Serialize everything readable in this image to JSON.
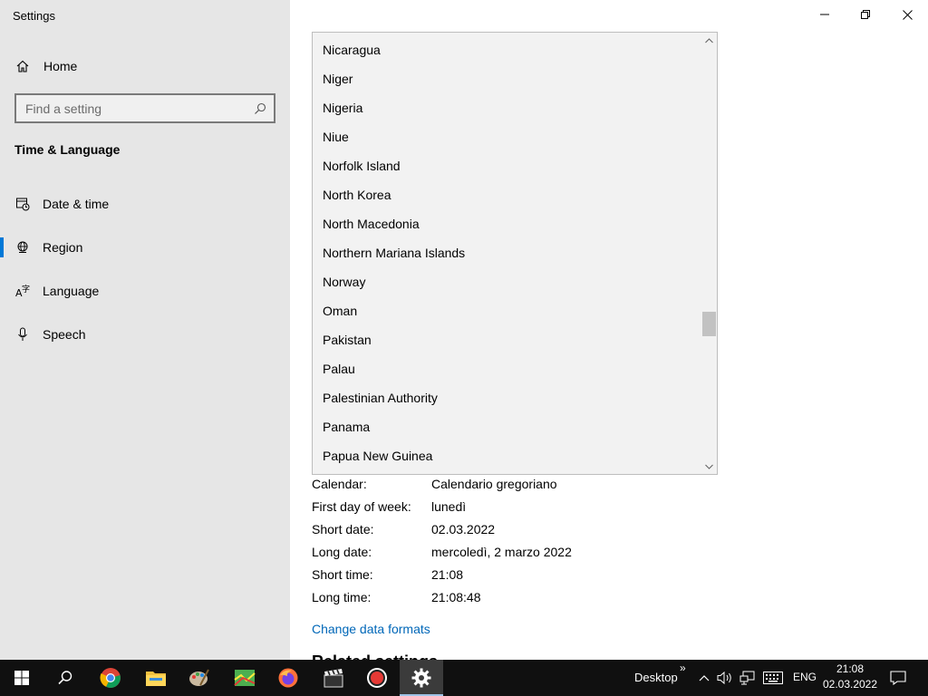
{
  "window": {
    "title": "Settings",
    "minimize_icon": "minimize-icon",
    "restore_icon": "restore-icon",
    "close_icon": "close-icon"
  },
  "sidebar": {
    "home": {
      "label": "Home",
      "icon": "home-icon"
    },
    "search": {
      "placeholder": "Find a setting",
      "value": "",
      "icon": "search-icon"
    },
    "section_title": "Time & Language",
    "items": [
      {
        "label": "Date & time",
        "icon": "calendar-clock-icon",
        "selected": false
      },
      {
        "label": "Region",
        "icon": "globe-icon",
        "selected": true
      },
      {
        "label": "Language",
        "icon": "language-icon",
        "selected": false
      },
      {
        "label": "Speech",
        "icon": "microphone-icon",
        "selected": false
      }
    ],
    "accent_color": "#0078d7"
  },
  "country_dropdown": {
    "items": [
      "Nicaragua",
      "Niger",
      "Nigeria",
      "Niue",
      "Norfolk Island",
      "North Korea",
      "North Macedonia",
      "Northern Mariana Islands",
      "Norway",
      "Oman",
      "Pakistan",
      "Palau",
      "Palestinian Authority",
      "Panama",
      "Papua New Guinea"
    ],
    "scroll_up_icon": "chevron-up-icon",
    "scroll_down_icon": "chevron-down-icon"
  },
  "regional_format": {
    "rows": [
      {
        "key": "Calendar:",
        "value": "Calendario gregoriano"
      },
      {
        "key": "First day of week:",
        "value": "lunedì"
      },
      {
        "key": "Short date:",
        "value": "02.03.2022"
      },
      {
        "key": "Long date:",
        "value": "mercoledì, 2 marzo 2022"
      },
      {
        "key": "Short time:",
        "value": "21:08"
      },
      {
        "key": "Long time:",
        "value": "21:08:48"
      }
    ],
    "change_link": "Change data formats",
    "link_color": "#0067b8",
    "related_heading": "Related settings"
  },
  "taskbar": {
    "apps": [
      {
        "name": "start",
        "icon": "windows-start-icon"
      },
      {
        "name": "search",
        "icon": "search-icon"
      },
      {
        "name": "chrome",
        "icon": "chrome-icon"
      },
      {
        "name": "file-explorer",
        "icon": "folder-icon"
      },
      {
        "name": "paint",
        "icon": "palette-icon"
      },
      {
        "name": "map-app",
        "icon": "map-icon"
      },
      {
        "name": "firefox",
        "icon": "firefox-icon"
      },
      {
        "name": "video-editor",
        "icon": "clapperboard-icon"
      },
      {
        "name": "recorder",
        "icon": "record-icon"
      },
      {
        "name": "settings",
        "icon": "gear-icon",
        "active": true
      }
    ],
    "desktop_label": "Desktop",
    "language": "ENG",
    "time": "21:08",
    "date": "02.03.2022"
  }
}
